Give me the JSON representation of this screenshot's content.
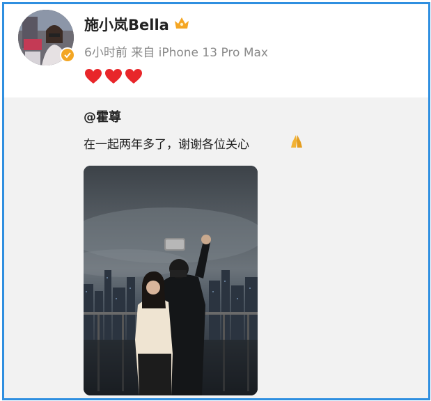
{
  "post": {
    "author_name": "施小岚Bella",
    "meta": "6小时前 来自 iPhone 13 Pro Max",
    "hearts": [
      "red-heart",
      "red-heart",
      "red-heart"
    ]
  },
  "repost": {
    "mention": "@霍尊",
    "text": "在一起两年多了，谢谢各位关心"
  },
  "colors": {
    "frame_border": "#2f8fe0",
    "verified_badge": "#f3a624",
    "heart": "#e8262a",
    "repost_bg": "#f2f2f2"
  },
  "icons": [
    "verified-badge-icon",
    "crown-icon",
    "heart-icon",
    "praying-hands-icon"
  ]
}
